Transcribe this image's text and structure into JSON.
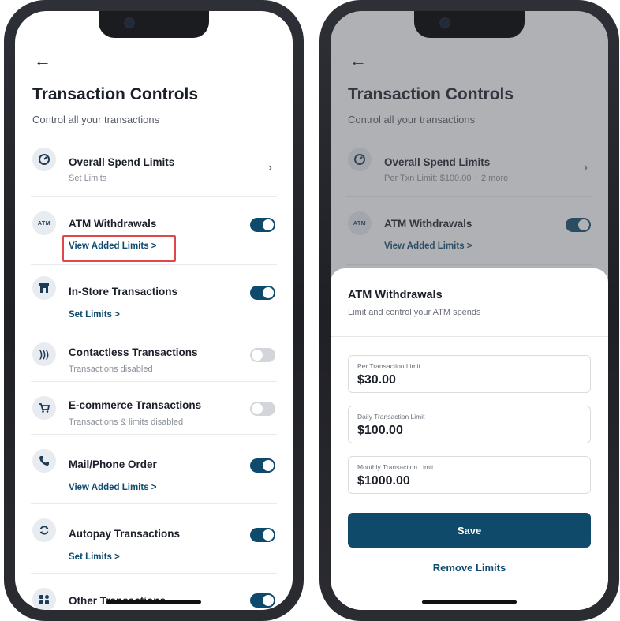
{
  "left_screen": {
    "back_icon": "arrow-left",
    "title": "Transaction Controls",
    "subtitle": "Control all your transactions",
    "items": [
      {
        "title": "Overall Spend Limits",
        "sub": "Set Limits",
        "control": "chevron",
        "icon": "speedometer-icon"
      },
      {
        "title": "ATM Withdrawals",
        "link": "View Added Limits  >",
        "control": "toggle",
        "state": "on",
        "icon": "atm-icon",
        "icon_text": "ATM"
      },
      {
        "title": "In-Store Transactions",
        "link": "Set Limits  >",
        "control": "toggle",
        "state": "on",
        "icon": "store-icon"
      },
      {
        "title": "Contactless Transactions",
        "sub": "Transactions disabled",
        "control": "toggle",
        "state": "off",
        "icon": "contactless-icon"
      },
      {
        "title": "E-commerce Transactions",
        "sub": "Transactions & limits disabled",
        "control": "toggle",
        "state": "off",
        "icon": "cart-icon"
      },
      {
        "title": "Mail/Phone Order",
        "link": "View Added Limits  >",
        "control": "toggle",
        "state": "on",
        "icon": "phone-icon"
      },
      {
        "title": "Autopay Transactions",
        "link": "Set Limits  >",
        "control": "toggle",
        "state": "on",
        "icon": "autopay-icon"
      },
      {
        "title": "Other Transactions",
        "control": "toggle",
        "state": "on",
        "icon": "grid-icon"
      }
    ]
  },
  "right_screen": {
    "title": "Transaction Controls",
    "subtitle": "Control all your transactions",
    "items": [
      {
        "title": "Overall Spend Limits",
        "sub": "Per Txn Limit: $100.00 + 2 more"
      },
      {
        "title": "ATM Withdrawals",
        "link": "View Added Limits  >",
        "icon_text": "ATM"
      }
    ],
    "sheet": {
      "title": "ATM Withdrawals",
      "subtitle": "Limit and control your ATM spends",
      "fields": [
        {
          "label": "Per Transaction Limit",
          "value": "$30.00"
        },
        {
          "label": "Daily Transaction Limit",
          "value": "$100.00"
        },
        {
          "label": "Monthly Transaction Limit",
          "value": "$1000.00"
        }
      ],
      "save_label": "Save",
      "remove_label": "Remove Limits"
    }
  },
  "colors": {
    "accent": "#0f4a6b",
    "toggle_off": "#d2d5da",
    "highlight": "#e0474a"
  }
}
